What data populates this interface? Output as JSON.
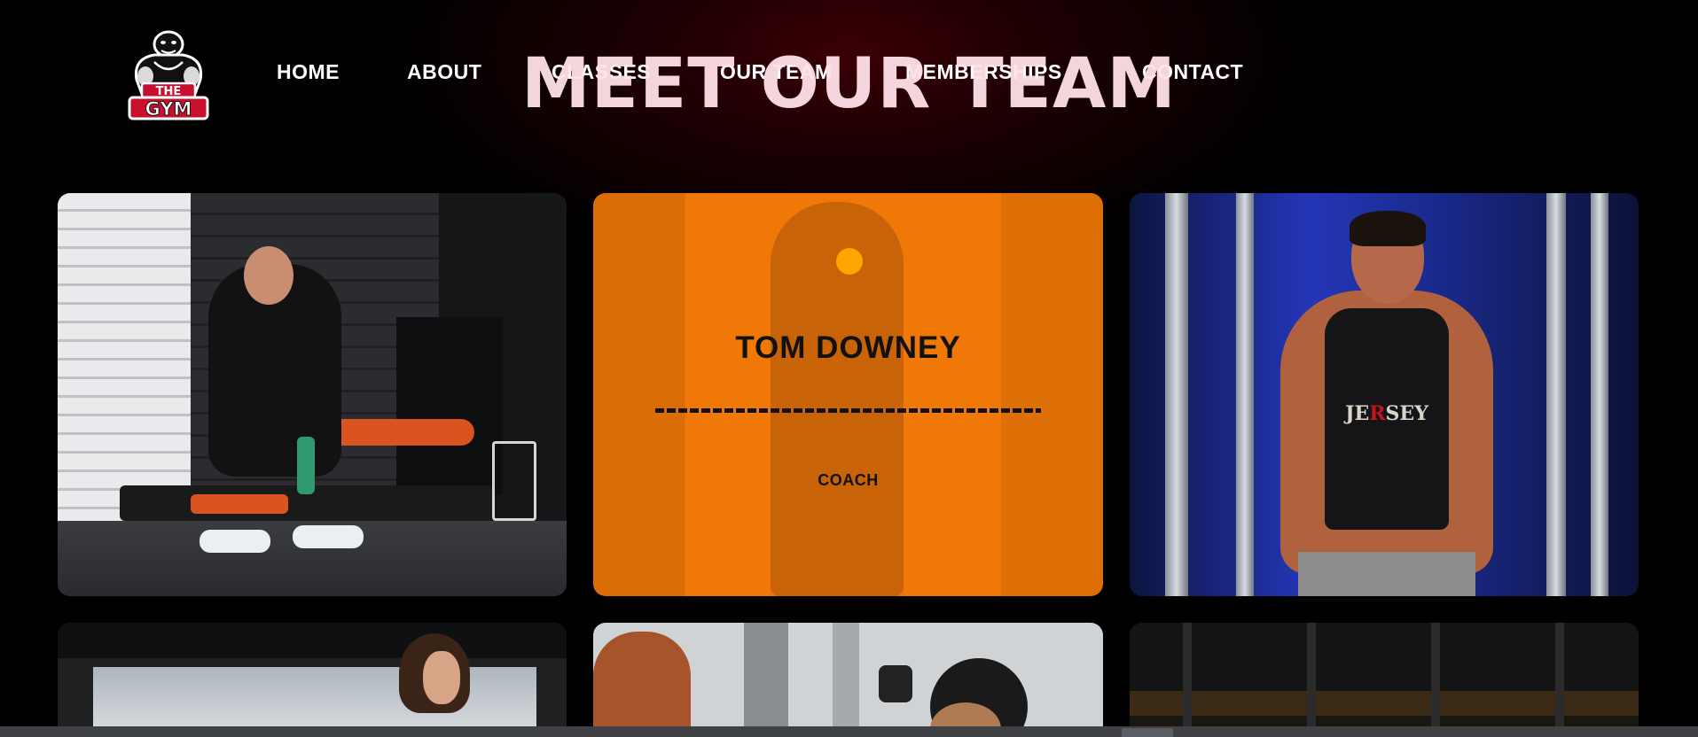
{
  "header": {
    "logo": {
      "icon": "gorilla-mascot-icon",
      "line1": "THE",
      "line2": "GYM",
      "colors": {
        "outline": "#ffffff",
        "accent": "#c8102e",
        "fill": "#111111"
      }
    },
    "nav": [
      {
        "label": "HOME"
      },
      {
        "label": "ABOUT"
      },
      {
        "label": "CLASSES"
      },
      {
        "label": "OUR TEAM"
      },
      {
        "label": "MEMBERSHIPS"
      },
      {
        "label": "CONTACT"
      }
    ]
  },
  "main": {
    "title": "MEET OUR TEAM",
    "cards": [
      {
        "image": "trainer-seated-on-bench-photo"
      },
      {
        "image": "trainer-with-headphones-photo",
        "highlighted": true,
        "name": "TOM DOWNEY",
        "divider": "----------------------------------",
        "role": "COACH",
        "overlay_color": "#f07806",
        "dot_color": "#ffa600"
      },
      {
        "image": "trainer-cable-crossover-photo",
        "shirt_text_parts": [
          "JE",
          "R",
          "SEY"
        ]
      },
      {
        "image": "female-trainer-photo"
      },
      {
        "image": "female-trainer-cable-machine-photo"
      },
      {
        "image": "empty-gym-interior-photo"
      }
    ]
  },
  "theme": {
    "background": "#000000",
    "glow": "#3a0005",
    "title_color": "#ffe1e8",
    "nav_color": "#ffffff"
  }
}
